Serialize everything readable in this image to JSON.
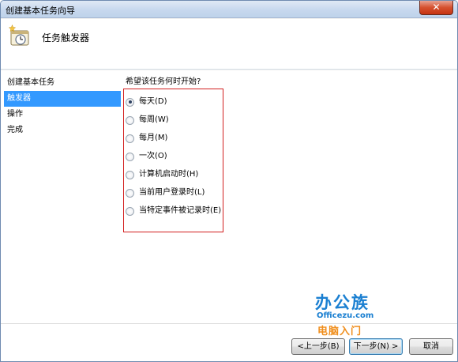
{
  "window": {
    "title": "创建基本任务向导",
    "close_label": "✕"
  },
  "header": {
    "title": "任务触发器",
    "icon": "clock-task-icon"
  },
  "nav": {
    "items": [
      {
        "label": "创建基本任务",
        "active": false
      },
      {
        "label": "触发器",
        "active": true
      },
      {
        "label": "操作",
        "active": false
      },
      {
        "label": "完成",
        "active": false
      }
    ]
  },
  "main": {
    "prompt": "希望该任务何时开始?",
    "options": [
      {
        "label": "每天(D)",
        "checked": true
      },
      {
        "label": "每周(W)",
        "checked": false
      },
      {
        "label": "每月(M)",
        "checked": false
      },
      {
        "label": "一次(O)",
        "checked": false
      },
      {
        "label": "计算机启动时(H)",
        "checked": false
      },
      {
        "label": "当前用户登录时(L)",
        "checked": false
      },
      {
        "label": "当特定事件被记录时(E)",
        "checked": false
      }
    ]
  },
  "buttons": {
    "back": "<上一步(B)",
    "next": "下一步(N) >",
    "cancel": "取消"
  },
  "watermark": {
    "brand": "办公族",
    "url": "Officezu.com",
    "sub": "电脑入门"
  },
  "colors": {
    "highlight": "#3399ff",
    "annotation_border": "#d21f1f",
    "watermark_blue": "#1a7fd1",
    "watermark_orange": "#f08e1c"
  }
}
